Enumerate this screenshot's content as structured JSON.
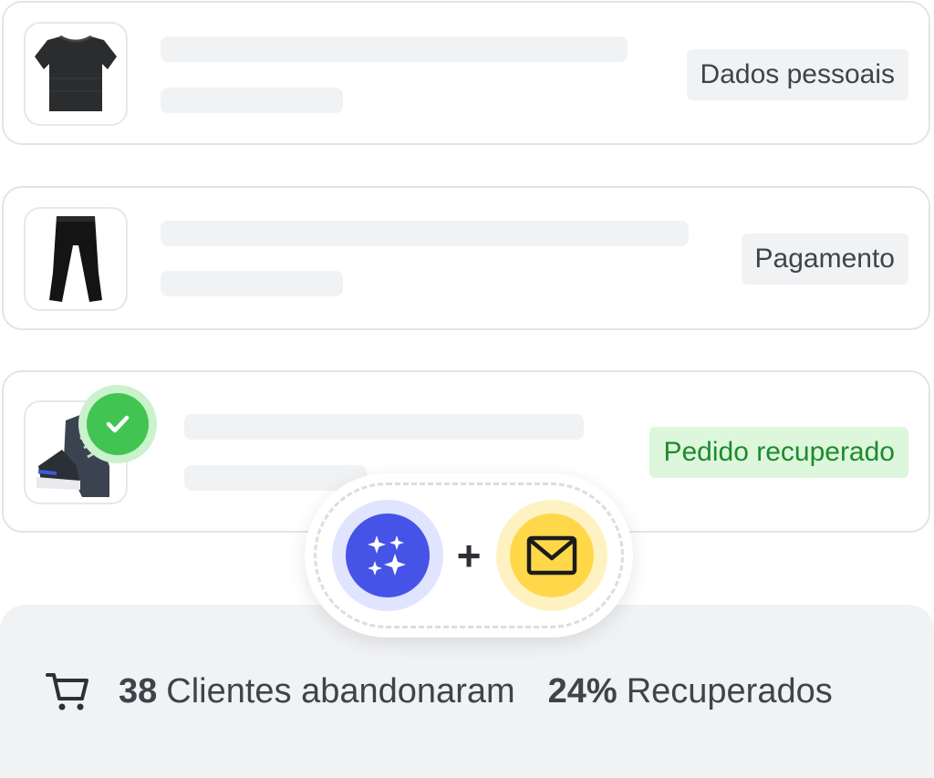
{
  "orders": [
    {
      "product_icon": "tshirt-icon",
      "status": "Dados pessoais",
      "status_color": "#f1f2f4"
    },
    {
      "product_icon": "pants-icon",
      "status": "Pagamento",
      "status_color": "#f1f2f4"
    },
    {
      "product_icon": "sneaker-icon",
      "status": "Pedido recuperado",
      "status_color": "#dcf7dc",
      "recovered": true
    }
  ],
  "channels": {
    "ai_icon": "sparkles-icon",
    "ai_color": "#4553e6",
    "plus": "+",
    "email_icon": "envelope-icon",
    "email_color": "#ffd84a"
  },
  "summary": {
    "cart_icon": "cart-icon",
    "abandoned_count": "38",
    "abandoned_label": "Clientes abandonaram",
    "recovered_pct": "24%",
    "recovered_label": "Recuperados"
  },
  "colors": {
    "success": "#42c453",
    "success_text": "#1e8a2e",
    "border": "#e3e4e8",
    "skeleton": "#f1f2f4"
  }
}
